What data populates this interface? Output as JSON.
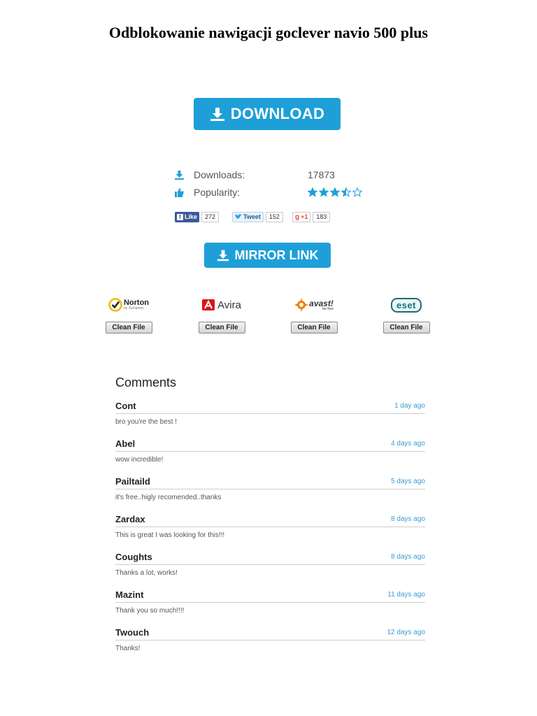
{
  "title": "Odblokowanie nawigacji goclever navio 500 plus",
  "download_button": {
    "label": "DOWNLOAD"
  },
  "stats": {
    "downloads_label": "Downloads:",
    "downloads_value": "17873",
    "popularity_label": "Popularity:",
    "popularity_stars": 3.5,
    "popularity_max": 5
  },
  "social": {
    "facebook": {
      "label": "Like",
      "count": "272"
    },
    "twitter": {
      "label": "Tweet",
      "count": "152"
    },
    "gplus": {
      "label": "+1",
      "count": "183"
    }
  },
  "mirror_button": {
    "label": "MIRROR LINK"
  },
  "antivirus": [
    {
      "name": "Norton",
      "sub": "by Symantec",
      "status": "Clean File"
    },
    {
      "name": "Avira",
      "status": "Clean File"
    },
    {
      "name": "avast!",
      "sub": "be free",
      "status": "Clean File"
    },
    {
      "name": "eset",
      "status": "Clean File"
    }
  ],
  "comments_heading": "Comments",
  "comments": [
    {
      "author": "Cont",
      "time": "1 day ago",
      "text": "bro you're the best !"
    },
    {
      "author": "Abel",
      "time": "4 days ago",
      "text": "wow incredible!"
    },
    {
      "author": "Pailtaild",
      "time": "5 days ago",
      "text": "it's free..higly recomended..thanks"
    },
    {
      "author": "Zardax",
      "time": "8 days ago",
      "text": "This is great I was looking for this!!!"
    },
    {
      "author": "Coughts",
      "time": "8 days ago",
      "text": "Thanks a lot, works!"
    },
    {
      "author": "Mazint",
      "time": "11 days ago",
      "text": "Thank you so much!!!!"
    },
    {
      "author": "Twouch",
      "time": "12 days ago",
      "text": "Thanks!"
    }
  ],
  "colors": {
    "accent": "#1e9fd8",
    "link": "#3a9bd5",
    "facebook": "#3b5998"
  }
}
